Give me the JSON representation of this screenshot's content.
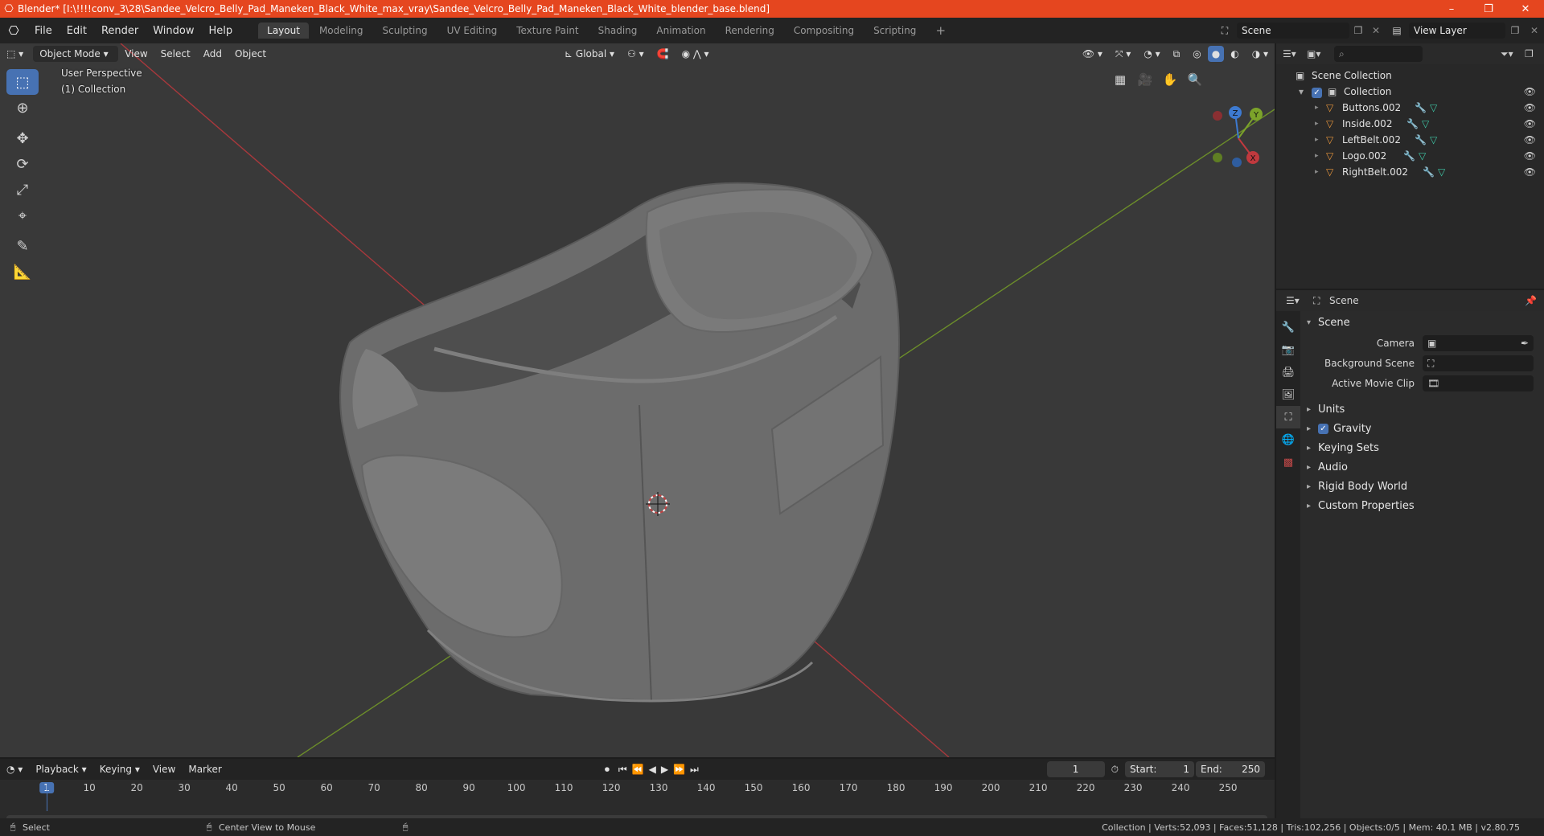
{
  "titlebar": {
    "title": "Blender* [I:\\!!!!conv_3\\28\\Sandee_Velcro_Belly_Pad_Maneken_Black_White_max_vray\\Sandee_Velcro_Belly_Pad_Maneken_Black_White_blender_base.blend]",
    "minimize": "–",
    "restore": "❐",
    "close": "✕"
  },
  "menubar": {
    "items": [
      "File",
      "Edit",
      "Render",
      "Window",
      "Help"
    ],
    "workspaces": [
      "Layout",
      "Modeling",
      "Sculpting",
      "UV Editing",
      "Texture Paint",
      "Shading",
      "Animation",
      "Rendering",
      "Compositing",
      "Scripting"
    ],
    "active_workspace": "Layout",
    "add_workspace": "+",
    "scene": "Scene",
    "view_layer": "View Layer"
  },
  "viewport": {
    "mode": "Object Mode",
    "menus": [
      "View",
      "Select",
      "Add",
      "Object"
    ],
    "transform_orientation": "Global",
    "perspective_label": "User Perspective",
    "collection_label": "(1) Collection",
    "gizmo_axes": [
      "X",
      "Y",
      "Z"
    ]
  },
  "outliner": {
    "root": "Scene Collection",
    "collection": "Collection",
    "objects": [
      "Buttons.002",
      "Inside.002",
      "LeftBelt.002",
      "Logo.002",
      "RightBelt.002"
    ]
  },
  "properties": {
    "context": "Scene",
    "panel_scene": "Scene",
    "camera_label": "Camera",
    "background_scene_label": "Background Scene",
    "active_movie_clip_label": "Active Movie Clip",
    "panels": [
      "Units",
      "Gravity",
      "Keying Sets",
      "Audio",
      "Rigid Body World",
      "Custom Properties"
    ],
    "gravity_checked": true
  },
  "timeline": {
    "menus": [
      "Playback",
      "Keying",
      "View",
      "Marker"
    ],
    "current_frame": "1",
    "start_label": "Start:",
    "start": "1",
    "end_label": "End:",
    "end": "250",
    "ticks": [
      "1",
      "10",
      "20",
      "30",
      "40",
      "50",
      "60",
      "70",
      "80",
      "90",
      "100",
      "110",
      "120",
      "130",
      "140",
      "150",
      "160",
      "170",
      "180",
      "190",
      "200",
      "210",
      "220",
      "230",
      "240",
      "250"
    ]
  },
  "statusbar": {
    "left_action": "Select",
    "middle_action": "Center View to Mouse",
    "stats": "Collection | Verts:52,093 | Faces:51,128 | Tris:102,256 | Objects:0/5 | Mem: 40.1 MB | v2.80.75"
  },
  "colors": {
    "accent": "#4772b3",
    "title_bar": "#e5461f",
    "viewport_bg": "#393939",
    "x_axis": "#c0393e",
    "y_axis": "#7ca32a",
    "object_icon": "#e8963c",
    "mesh_icon": "#3fc7a6"
  }
}
